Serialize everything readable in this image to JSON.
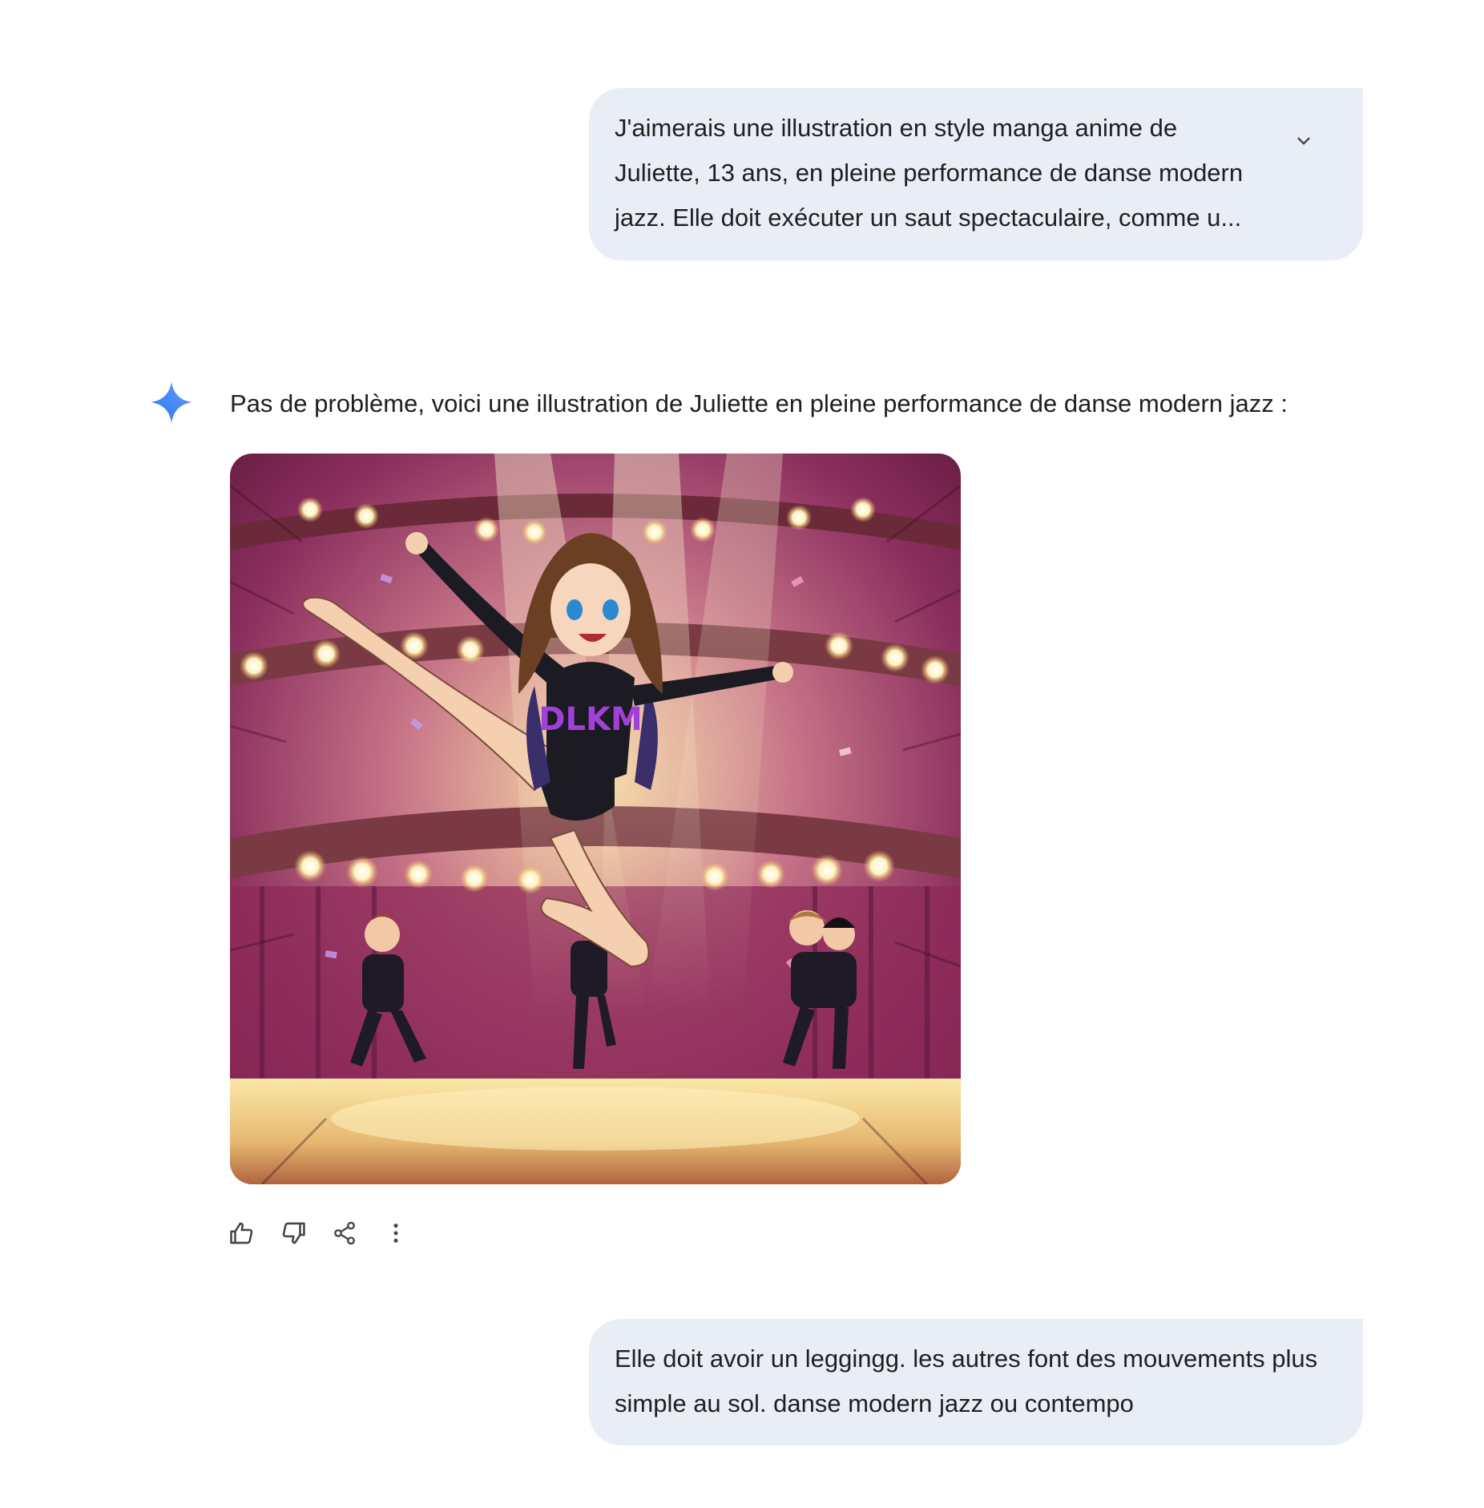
{
  "conversation": {
    "user_prompt_1": "J'aimerais une illustration en style manga anime de Juliette, 13 ans, en pleine performance de danse modern jazz. Elle doit exécuter un saut spectaculaire, comme u...",
    "model_response": "Pas de problème, voici une illustration de Juliette en pleine performance de danse modern jazz :",
    "user_prompt_2": "Elle doit avoir un leggingg. les autres font des mouvements plus simple au sol. danse modern jazz ou contempo"
  },
  "image": {
    "shirt_text": "DLKM",
    "icon": "generated-image"
  },
  "actions": {
    "icons": [
      "thumb-up-icon",
      "thumb-down-icon",
      "share-icon",
      "more-vert-icon"
    ]
  },
  "colors": {
    "bubble_bg": "#e9eef6",
    "text": "#1f1f1f",
    "icon": "#444746",
    "gemini_blue": "#4285f4"
  }
}
